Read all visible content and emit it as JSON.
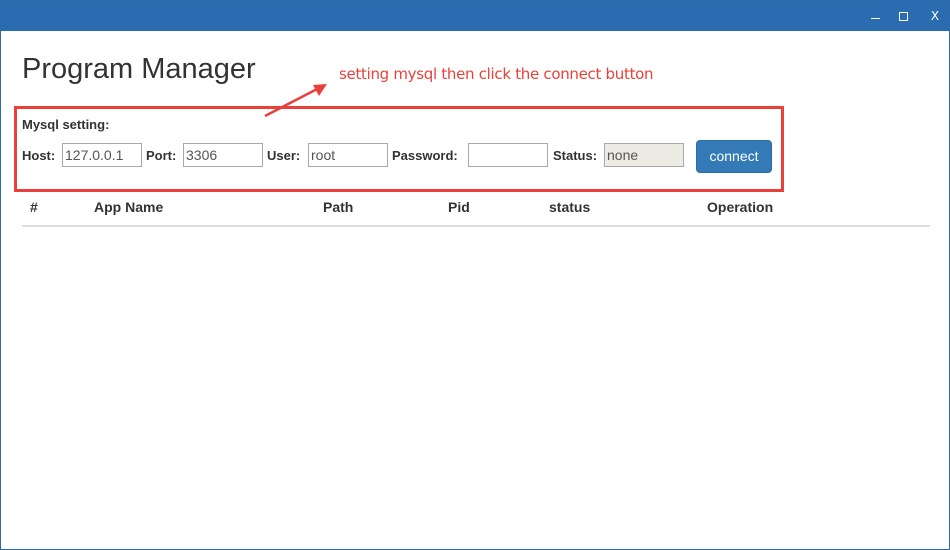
{
  "window": {
    "title": "",
    "controls": {
      "minimize_icon": "minimize-icon",
      "maximize_icon": "maximize-icon",
      "close_label": "X"
    },
    "titlebar_color": "#2b6cb0"
  },
  "header": {
    "title": "Program Manager"
  },
  "annotation": {
    "text": "setting mysql then click the connect button",
    "color": "#e8413b"
  },
  "mysql": {
    "section_label": "Mysql setting:",
    "host_label": "Host:",
    "host_value": "127.0.0.1",
    "port_label": "Port:",
    "port_value": "3306",
    "user_label": "User:",
    "user_value": "root",
    "password_label": "Password:",
    "password_value": "",
    "status_label": "Status:",
    "status_value": "none",
    "connect_label": "connect",
    "button_color": "#337ab7"
  },
  "table": {
    "columns": [
      "#",
      "App Name",
      "Path",
      "Pid",
      "status",
      "Operation"
    ],
    "rows": []
  }
}
